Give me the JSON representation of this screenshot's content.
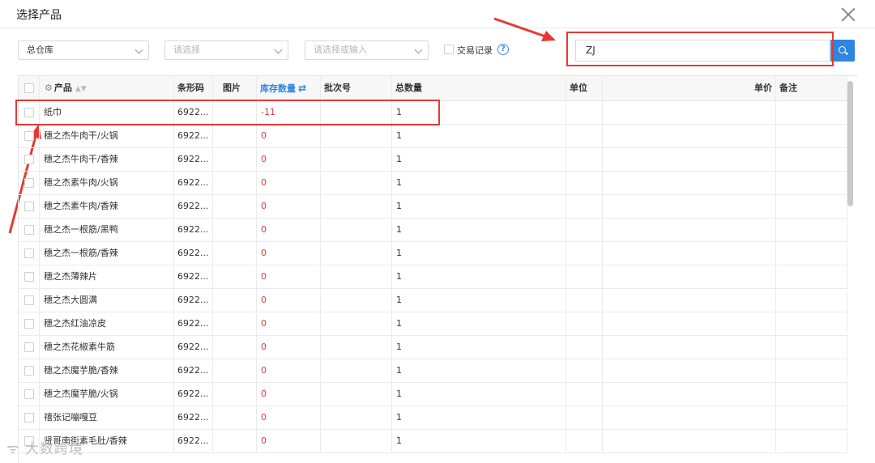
{
  "dialog": {
    "title": "选择产品"
  },
  "filters": {
    "warehouse": "总仓库",
    "select_placeholder": "请选择",
    "select_or_input_placeholder": "请选择或输入",
    "trade_record_label": "交易记录",
    "help_icon_glyph": "?",
    "search_value": "ZJ"
  },
  "table": {
    "headers": {
      "product": "产品",
      "barcode": "条形码",
      "image": "图片",
      "stock_qty": "库存数量",
      "batch_no": "批次号",
      "total_qty": "总数量",
      "unit": "单位",
      "unit_price": "单价",
      "remark": "备注"
    },
    "rows": [
      {
        "product": "纸巾",
        "barcode": "6922...",
        "stock": "-11",
        "total": "1"
      },
      {
        "product": "穗之杰牛肉干/火锅",
        "barcode": "6922...",
        "stock": "0",
        "total": "1"
      },
      {
        "product": "穗之杰牛肉干/香辣",
        "barcode": "6922...",
        "stock": "0",
        "total": "1"
      },
      {
        "product": "穗之杰素牛肉/火锅",
        "barcode": "6922...",
        "stock": "0",
        "total": "1"
      },
      {
        "product": "穗之杰素牛肉/香辣",
        "barcode": "6922...",
        "stock": "0",
        "total": "1"
      },
      {
        "product": "穗之杰一根筋/黑鸭",
        "barcode": "6922...",
        "stock": "0",
        "total": "1"
      },
      {
        "product": "穗之杰一根筋/香辣",
        "barcode": "6922...",
        "stock": "0",
        "total": "1"
      },
      {
        "product": "穗之杰薄辣片",
        "barcode": "6922...",
        "stock": "0",
        "total": "1"
      },
      {
        "product": "穗之杰大圆满",
        "barcode": "6922...",
        "stock": "0",
        "total": "1"
      },
      {
        "product": "穗之杰红油凉皮",
        "barcode": "6922...",
        "stock": "0",
        "total": "1"
      },
      {
        "product": "穗之杰花椒素牛筋",
        "barcode": "6922...",
        "stock": "0",
        "total": "1"
      },
      {
        "product": "穗之杰魔芋脆/香辣",
        "barcode": "6922...",
        "stock": "0",
        "total": "1"
      },
      {
        "product": "穗之杰魔芋脆/火锅",
        "barcode": "6922...",
        "stock": "0",
        "total": "1"
      },
      {
        "product": "禧张记嘣嘎豆",
        "barcode": "6922...",
        "stock": "0",
        "total": "1"
      },
      {
        "product": "贤哥南街素毛肚/香辣",
        "barcode": "6922...",
        "stock": "0",
        "total": "1"
      }
    ]
  },
  "watermark": {
    "text": "大数跨境"
  },
  "colors": {
    "accent": "#2f86de",
    "annotation": "#e53935",
    "negative": "#e53935"
  }
}
